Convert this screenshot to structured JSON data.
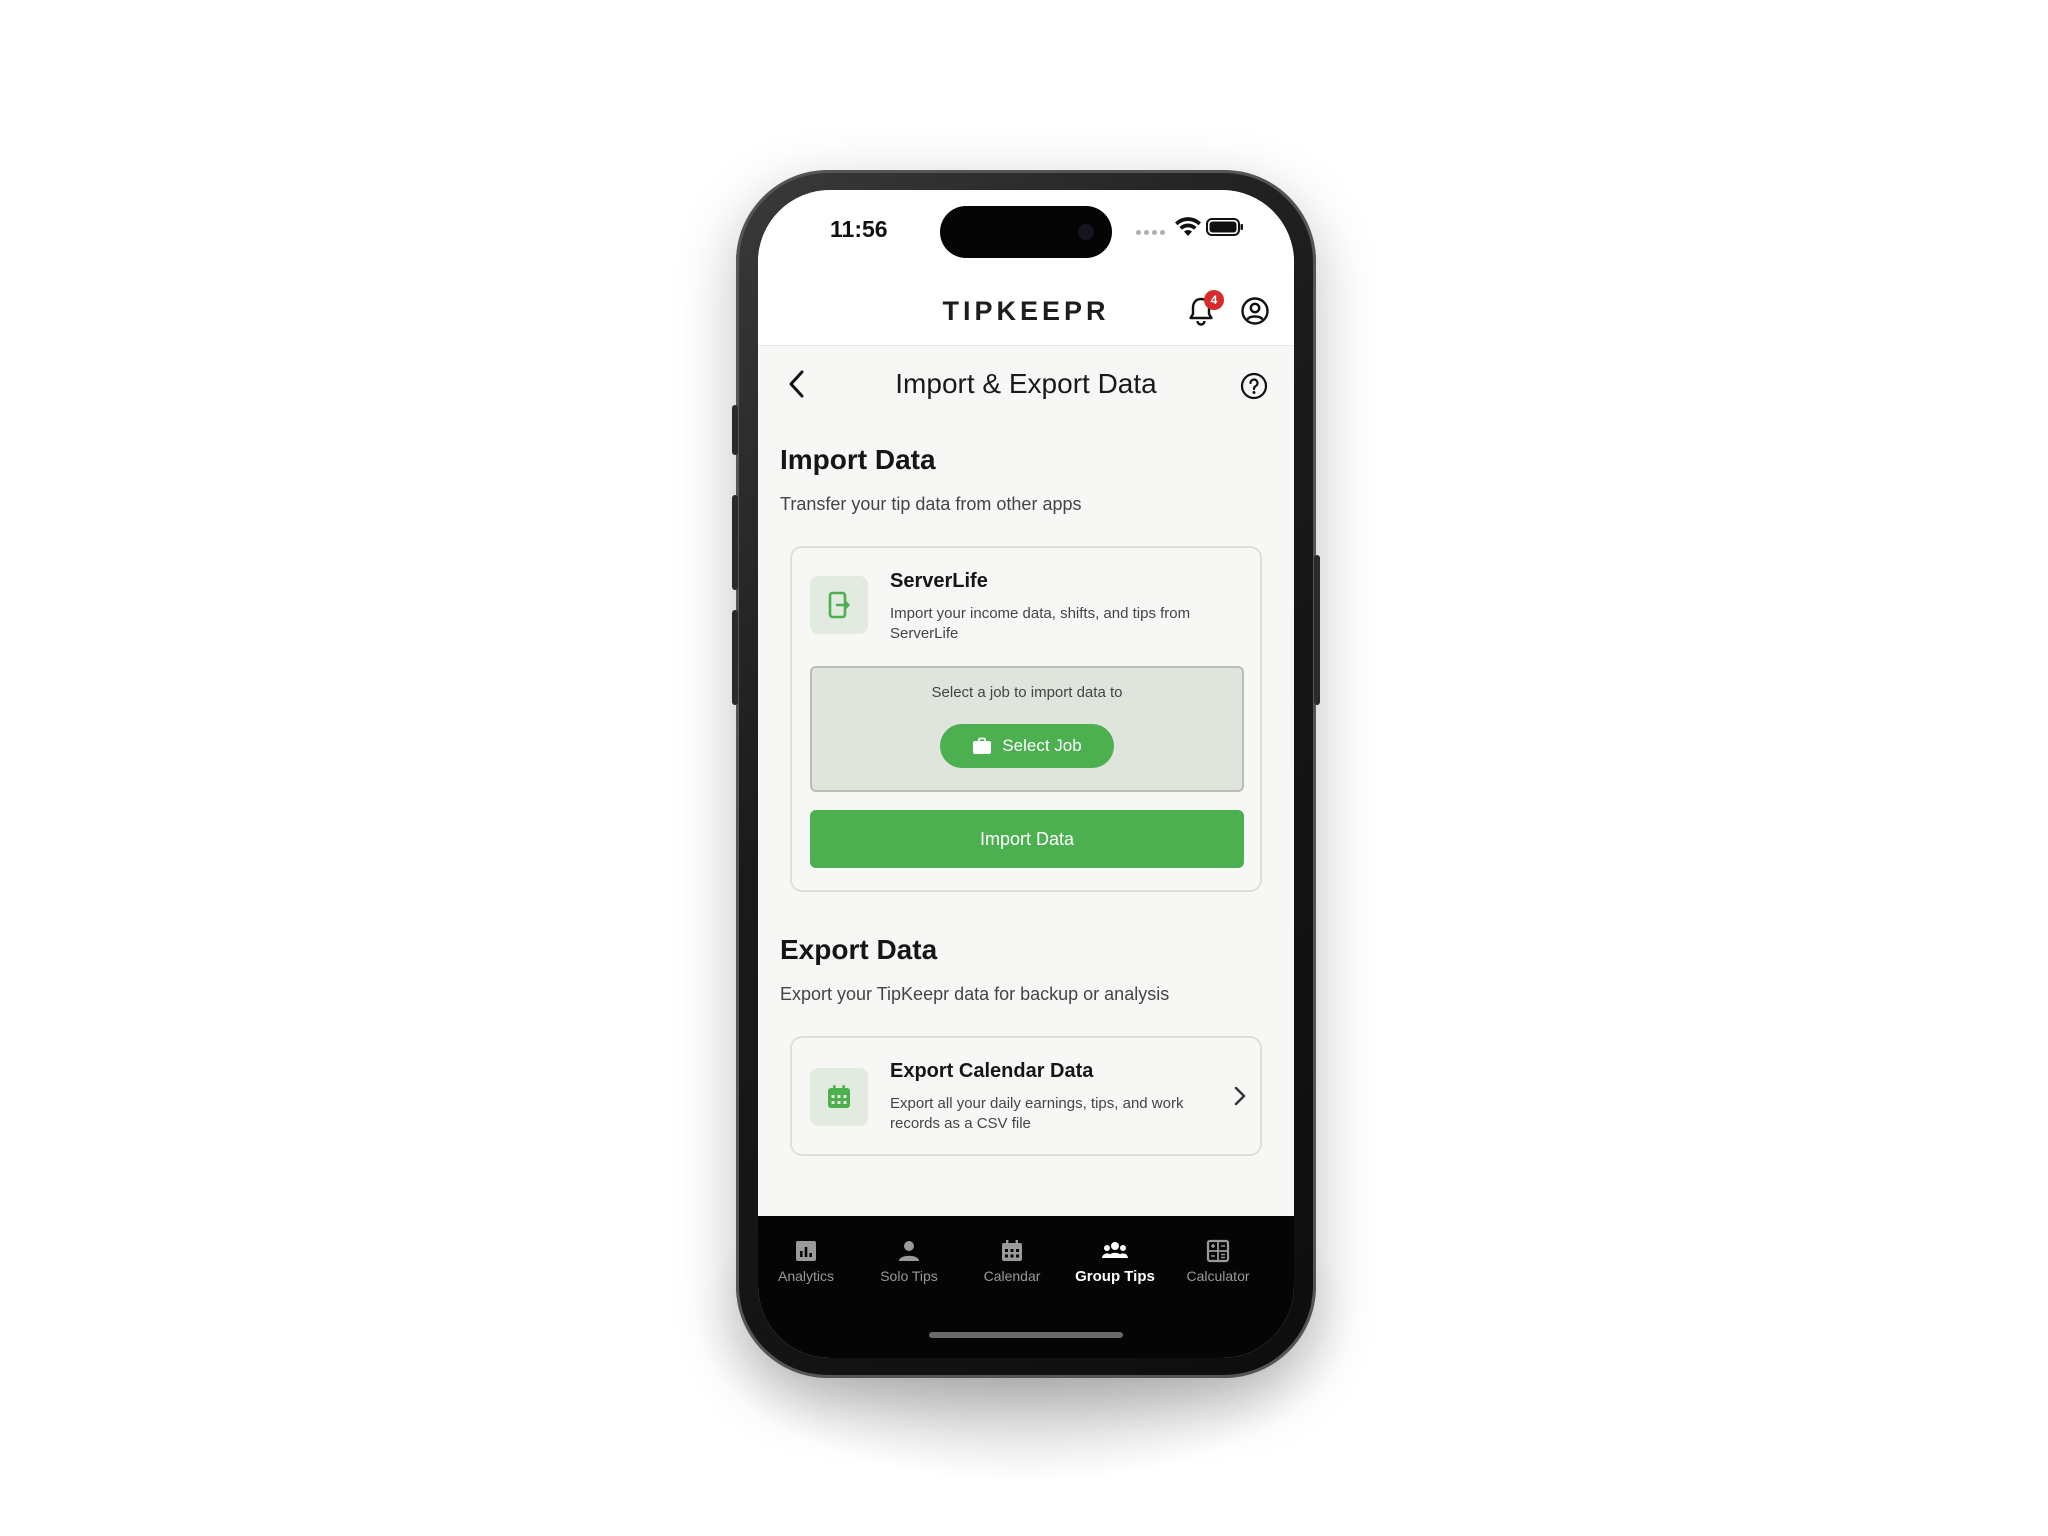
{
  "status": {
    "time": "11:56"
  },
  "header": {
    "brand": "TIPKEEPR",
    "notification_count": "4"
  },
  "titlebar": {
    "title": "Import & Export Data"
  },
  "import": {
    "title": "Import Data",
    "subtitle": "Transfer your tip data from other apps",
    "card": {
      "title": "ServerLife",
      "description": "Import your income data, shifts, and tips from ServerLife",
      "job_label": "Select a job to import data to",
      "select_job": "Select Job",
      "import_button": "Import Data"
    }
  },
  "export": {
    "title": "Export Data",
    "subtitle": "Export your TipKeepr data for backup or analysis",
    "card": {
      "title": "Export Calendar Data",
      "description": "Export all your daily earnings, tips, and work records as a CSV file"
    }
  },
  "tabs": [
    {
      "label": "Analytics",
      "icon": "analytics-icon"
    },
    {
      "label": "Solo Tips",
      "icon": "person-icon"
    },
    {
      "label": "Calendar",
      "icon": "calendar-icon"
    },
    {
      "label": "Group Tips",
      "icon": "group-icon",
      "active": true
    },
    {
      "label": "Calculator",
      "icon": "calculator-icon"
    }
  ],
  "colors": {
    "accent": "#4caf50",
    "badge": "#d52b2b",
    "tabbar": "#050505"
  }
}
